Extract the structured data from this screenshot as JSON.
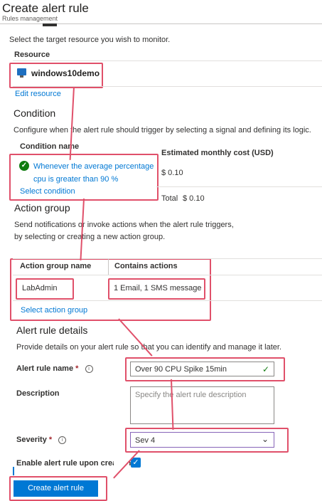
{
  "header": {
    "title": "Create alert rule",
    "subtitle": "Rules management"
  },
  "scope": {
    "instruction": "Select the target resource you wish to monitor.",
    "resource_header": "Resource",
    "resource_name": "windows10demo",
    "resource_icon": "monitor-icon",
    "edit_link": "Edit resource"
  },
  "condition": {
    "title": "Condition",
    "description": "Configure when the alert rule should trigger by selecting a signal and defining its logic.",
    "name_header": "Condition name",
    "cost_header": "Estimated monthly cost (USD)",
    "condition_line1": "Whenever the average percentage",
    "condition_line2": "cpu is greater than 90 %",
    "cost_value": "$ 0.10",
    "select_link": "Select condition",
    "total_label": "Total",
    "total_value": "$ 0.10",
    "status_icon": "check-circle-icon"
  },
  "action_group": {
    "title": "Action group",
    "description_line1": "Send notifications or invoke actions when the alert rule triggers,",
    "description_line2": "by selecting or creating a new action group.",
    "col_name": "Action group name",
    "col_actions": "Contains actions",
    "row_name": "LabAdmin",
    "row_actions": "1 Email, 1 SMS message",
    "select_link": "Select action group"
  },
  "details": {
    "title": "Alert rule details",
    "description": "Provide details on your alert rule so that you can identify and manage it later.",
    "name_label": "Alert rule name",
    "name_value": "Over 90 CPU Spike 15min",
    "required_mark": "*",
    "info_glyph": "i",
    "description_label": "Description",
    "description_placeholder": "Specify the alert rule description",
    "severity_label": "Severity",
    "severity_value": "Sev 4",
    "enable_label": "Enable alert rule upon creation",
    "enable_checked": true
  },
  "footer": {
    "create_button": "Create alert rule"
  },
  "colors": {
    "accent": "#0078d4",
    "annotation": "#e0506a",
    "success": "#107c10"
  }
}
